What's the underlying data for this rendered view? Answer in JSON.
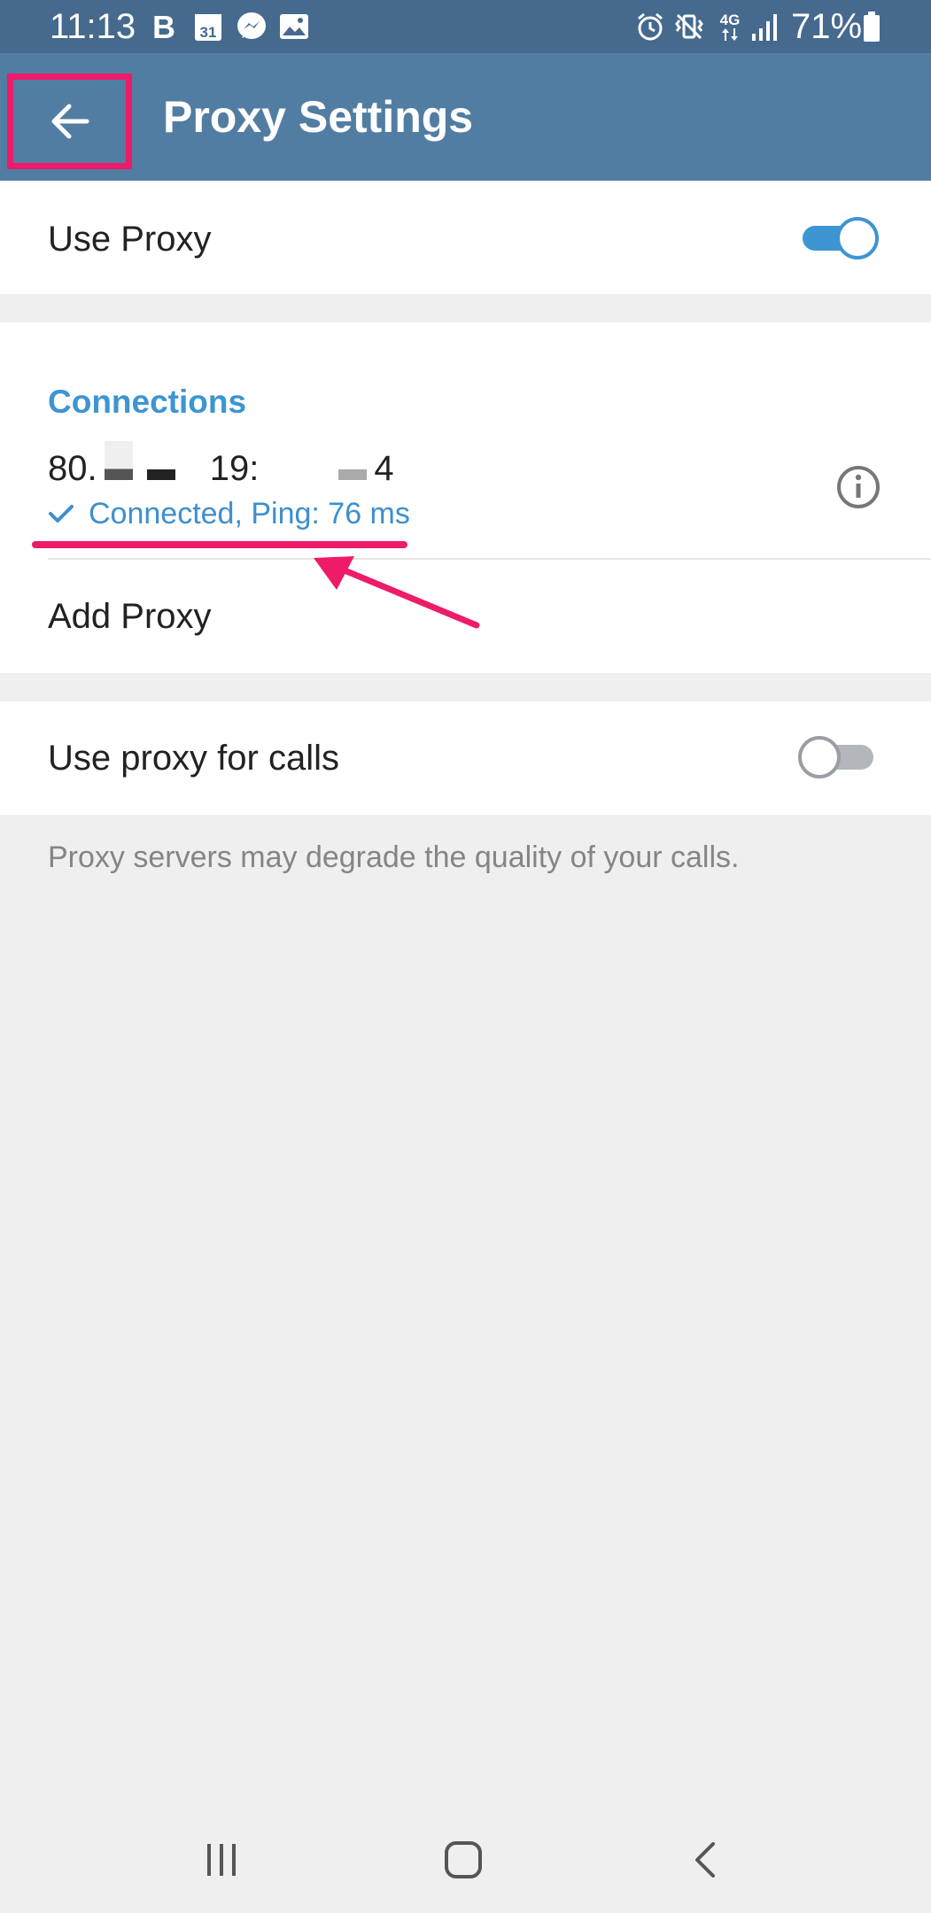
{
  "status_bar": {
    "time": "11:13",
    "calendar_day": "31",
    "network_type": "4G",
    "battery_percent": "71%",
    "icons": [
      "b-app-icon",
      "calendar-icon",
      "messenger-icon",
      "gallery-icon",
      "alarm-icon",
      "vibrate-icon",
      "network-4g-icon",
      "signal-icon",
      "battery-icon"
    ]
  },
  "app_bar": {
    "title": "Proxy Settings",
    "back_icon": "arrow-left-icon"
  },
  "use_proxy": {
    "label": "Use Proxy",
    "enabled": true
  },
  "connections": {
    "header": "Connections",
    "proxy": {
      "address_parts": [
        "80.",
        "19:",
        "4"
      ],
      "status": "Connected, Ping: 76 ms",
      "status_icon": "check-icon",
      "info_icon": "info-icon"
    },
    "add_proxy_label": "Add Proxy"
  },
  "use_proxy_for_calls": {
    "label": "Use proxy for calls",
    "enabled": false
  },
  "footer_note": "Proxy servers may degrade the quality of your calls.",
  "nav_bar": {
    "icons": [
      "recent-apps-icon",
      "home-icon",
      "back-nav-icon"
    ]
  },
  "colors": {
    "status_bar": "#46698e",
    "app_bar": "#527da3",
    "accent": "#3d95d2",
    "annotation": "#ed1b6a",
    "background": "#efefef"
  }
}
